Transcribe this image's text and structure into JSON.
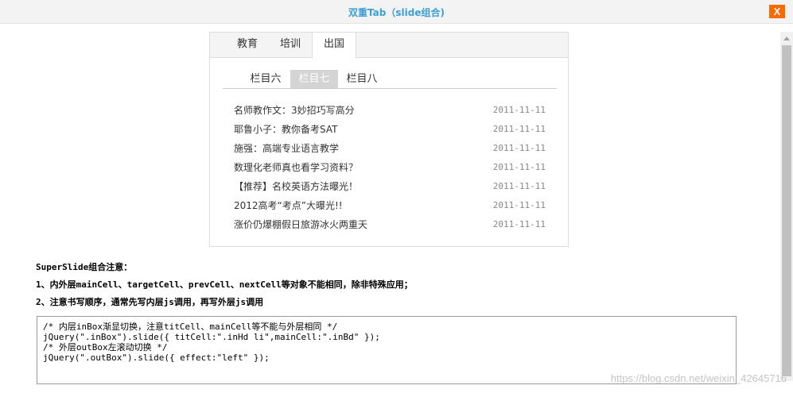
{
  "dialog": {
    "title": "双重Tab（slide组合)",
    "close_label": "X"
  },
  "outer_tabs": [
    {
      "label": "教育",
      "active": false
    },
    {
      "label": "培训",
      "active": false
    },
    {
      "label": "出国",
      "active": true
    }
  ],
  "inner_tabs": [
    {
      "label": "栏目六",
      "active": false
    },
    {
      "label": "栏目七",
      "active": true
    },
    {
      "label": "栏目八",
      "active": false
    }
  ],
  "news": [
    {
      "title": "名师教作文：3妙招巧写高分",
      "date": "2011-11-11"
    },
    {
      "title": "耶鲁小子：教你备考SAT",
      "date": "2011-11-11"
    },
    {
      "title": "施强：高端专业语言教学",
      "date": "2011-11-11"
    },
    {
      "title": "数理化老师真也看学习资料？",
      "date": "2011-11-11"
    },
    {
      "title": "【推荐】名校英语方法曝光！",
      "date": "2011-11-11"
    },
    {
      "title": "2012高考“考点”大曝光!!",
      "date": "2011-11-11"
    },
    {
      "title": "涨价仍爆棚假日旅游冰火两重天",
      "date": "2011-11-11"
    }
  ],
  "notes": {
    "heading": "SuperSlide组合注意：",
    "line1": "1、内外层mainCell、targetCell、prevCell、nextCell等对象不能相同，除非特殊应用；",
    "line2": "2、注意书写顺序，通常先写内层js调用，再写外层js调用"
  },
  "code": {
    "line1": "/* 内层inBox渐显切换，注意titCell、mainCell等不能与外层相同 */",
    "line2": "jQuery(\".inBox\").slide({ titCell:\".inHd li\",mainCell:\".inBd\" });",
    "line3": "/* 外层outBox左滚动切换 */",
    "line4": "jQuery(\".outBox\").slide({ effect:\"left\" });"
  },
  "watermark": "https://blog.csdn.net/weixin_42645716"
}
